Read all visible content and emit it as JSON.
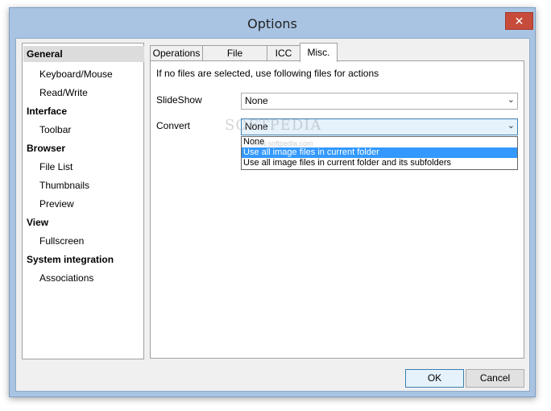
{
  "window": {
    "title": "Options",
    "close_symbol": "✕"
  },
  "sidebar": {
    "items": [
      {
        "label": "General",
        "level": "head",
        "selected": true
      },
      {
        "label": "Keyboard/Mouse",
        "level": "sub"
      },
      {
        "label": "Read/Write",
        "level": "sub"
      },
      {
        "label": "Interface",
        "level": "head"
      },
      {
        "label": "Toolbar",
        "level": "sub"
      },
      {
        "label": "Browser",
        "level": "head"
      },
      {
        "label": "File List",
        "level": "sub"
      },
      {
        "label": "Thumbnails",
        "level": "sub"
      },
      {
        "label": "Preview",
        "level": "sub"
      },
      {
        "label": "View",
        "level": "head"
      },
      {
        "label": "Fullscreen",
        "level": "sub"
      },
      {
        "label": "System integration",
        "level": "head"
      },
      {
        "label": "Associations",
        "level": "sub"
      }
    ]
  },
  "tabs": [
    {
      "label": "Operations"
    },
    {
      "label": "File Operations"
    },
    {
      "label": "ICC"
    },
    {
      "label": "Misc.",
      "active": true
    }
  ],
  "panel": {
    "description": "If no files are selected, use following files for actions",
    "slideshow": {
      "label": "SlideShow",
      "value": "None"
    },
    "convert": {
      "label": "Convert",
      "value": "None",
      "options": [
        "None",
        "Use all image files in current folder",
        "Use all image files in current folder and its subfolders"
      ],
      "highlighted_option": "Use all image files in current folder"
    }
  },
  "watermark": {
    "text": "SOFTPEDIA",
    "sub": "www.softpedia.com"
  },
  "buttons": {
    "ok": "OK",
    "cancel": "Cancel"
  },
  "icons": {
    "dropdown_arrow": "⌄"
  }
}
